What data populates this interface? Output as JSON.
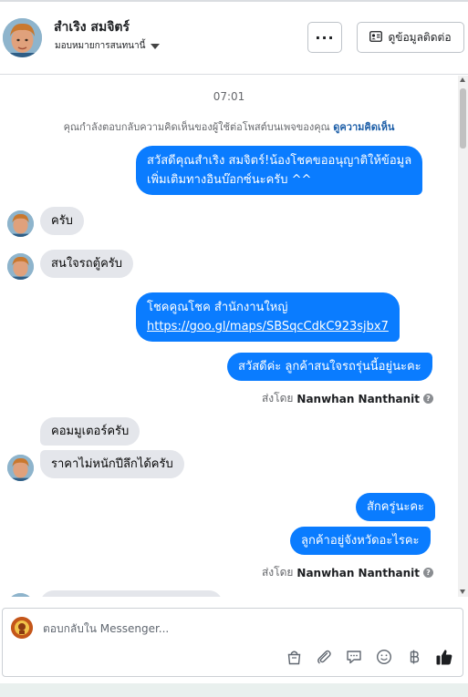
{
  "header": {
    "name": "สำเริง สมจิตร์",
    "assign_label": "มอบหมายการสนทนานี้",
    "more_label": "···",
    "contact_label": "ดูข้อมูลติดต่อ"
  },
  "chat": {
    "time": "07:01",
    "notice": "คุณกำลังตอบกลับความคิดเห็นของผู้ใช้ต่อโพสต์บนเพจของคุณ",
    "notice_link": "ดูความคิดเห็น",
    "messages": [
      {
        "text": "สวัสดีคุณสำเริง สมจิตร์!น้องโชคขออนุญาติให้ข้อมูล"
      },
      {
        "text": "เพิ่มเติมทางอินบ๊อกซ์นะครับ ^^"
      },
      {
        "text": "ครับ"
      },
      {
        "text": "สนใจรถตู้ครับ"
      },
      {
        "text": "โชคคูณโชค สำนักงานใหญ่"
      },
      {
        "text": "https://goo.gl/maps/SBSqcCdkC923sjbx7"
      },
      {
        "text": "สวัสดีค่ะ ลูกค้าสนใจรถรุ่นนี้อยู่นะคะ"
      },
      {
        "text": "คอมมูเตอร์ครับ"
      },
      {
        "text": "ราคาไม่หนักปีลึกได้ครับ"
      },
      {
        "text": "สักครู่นะคะ"
      },
      {
        "text": "ลูกค้าอยู่จังหวัดอะไรคะ"
      }
    ],
    "sent_by_prefix": "ส่งโดย",
    "sent_by_name": "Nanwhan Nanthanit"
  },
  "composer": {
    "placeholder": "ตอบกลับใน Messenger..."
  },
  "icons": {
    "tools": [
      "shop-icon",
      "attachment-icon",
      "saved-reply-icon",
      "emoji-icon",
      "baht-icon",
      "like-icon"
    ]
  },
  "colors": {
    "outgoing": "#0a7cff",
    "incoming": "#e4e6eb",
    "link": "#1e5fa8"
  }
}
